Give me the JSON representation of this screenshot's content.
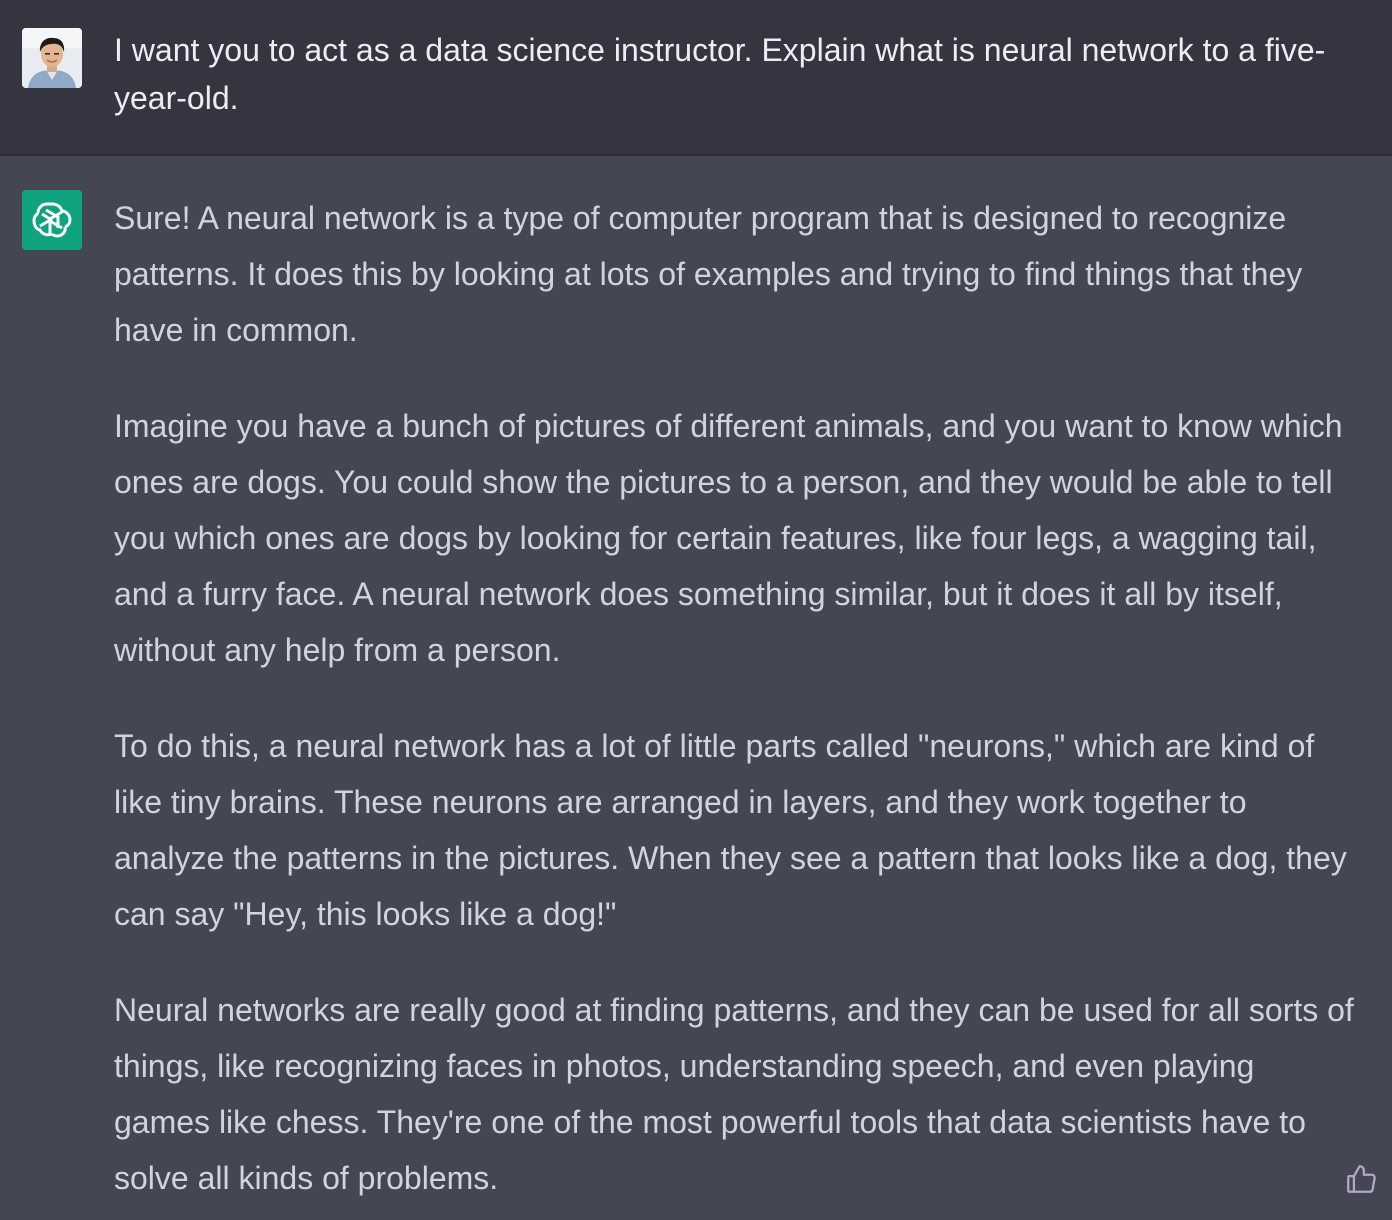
{
  "user_message": {
    "text": "I want you to act as a data science instructor. Explain what is neural network to a five-year-old."
  },
  "assistant_message": {
    "paragraphs": [
      "Sure! A neural network is a type of computer program that is designed to recognize patterns. It does this by looking at lots of examples and trying to find things that they have in common.",
      "Imagine you have a bunch of pictures of different animals, and you want to know which ones are dogs. You could show the pictures to a person, and they would be able to tell you which ones are dogs by looking for certain features, like four legs, a wagging tail, and a furry face. A neural network does something similar, but it does it all by itself, without any help from a person.",
      "To do this, a neural network has a lot of little parts called \"neurons,\" which are kind of like tiny brains. These neurons are arranged in layers, and they work together to analyze the patterns in the pictures. When they see a pattern that looks like a dog, they can say \"Hey, this looks like a dog!\"",
      "Neural networks are really good at finding patterns, and they can be used for all sorts of things, like recognizing faces in photos, understanding speech, and even playing games like chess. They're one of the most powerful tools that data scientists have to solve all kinds of problems."
    ]
  },
  "icons": {
    "user_avatar": "user-avatar-photo",
    "assistant_logo": "openai-logo-icon",
    "feedback": "thumbs-up-icon"
  },
  "colors": {
    "user_bg": "#343541",
    "assistant_bg": "#444654",
    "assistant_logo_bg": "#10a37f",
    "text": "#d1d5db"
  }
}
